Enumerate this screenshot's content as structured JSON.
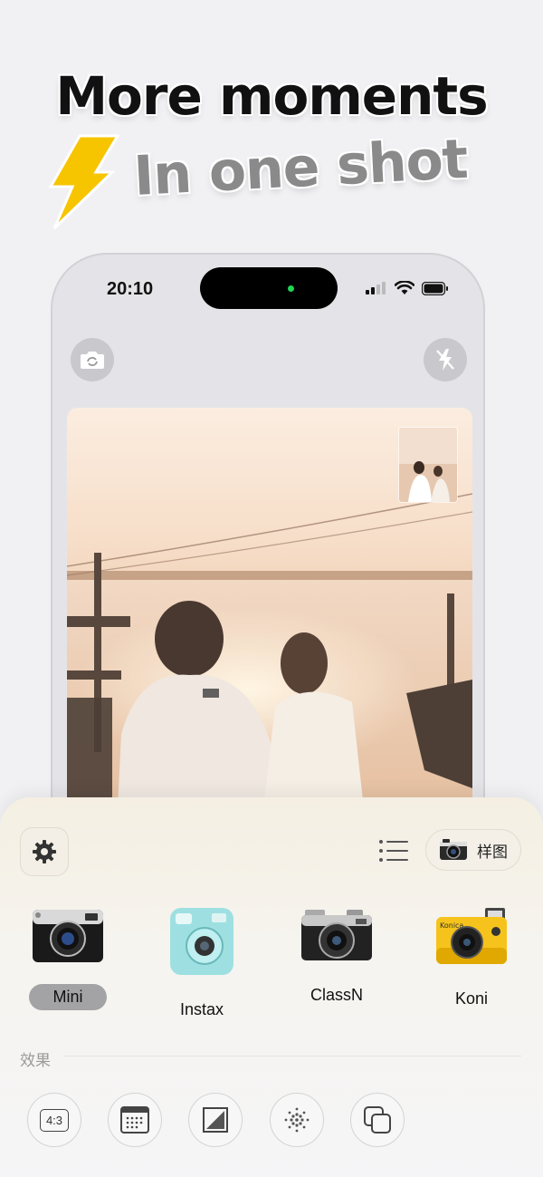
{
  "headline": {
    "line1": "More moments",
    "line2": "In one shot"
  },
  "colors": {
    "bolt": "#f7c400",
    "accent_dot": "#1fd655",
    "selected_chip": "#a3a3a6"
  },
  "status_bar": {
    "time": "20:10"
  },
  "icons": {
    "flip_camera": "camera-flip-icon",
    "flash": "flash-off-icon",
    "settings": "gear-icon",
    "list": "list-icon",
    "sample_camera": "camera-icon"
  },
  "toolbar": {
    "sample_label": "样图"
  },
  "cameras": [
    {
      "label": "Mini",
      "selected": true
    },
    {
      "label": "Instax",
      "selected": false
    },
    {
      "label": "ClassN",
      "selected": false
    },
    {
      "label": "Koni",
      "selected": false
    }
  ],
  "effects": {
    "title": "效果",
    "items": [
      {
        "label": "4:3",
        "icon": "aspect-ratio-icon"
      },
      {
        "icon": "date-stamp-icon"
      },
      {
        "icon": "frame-icon"
      },
      {
        "icon": "grain-icon"
      },
      {
        "icon": "multi-exposure-icon"
      }
    ]
  }
}
